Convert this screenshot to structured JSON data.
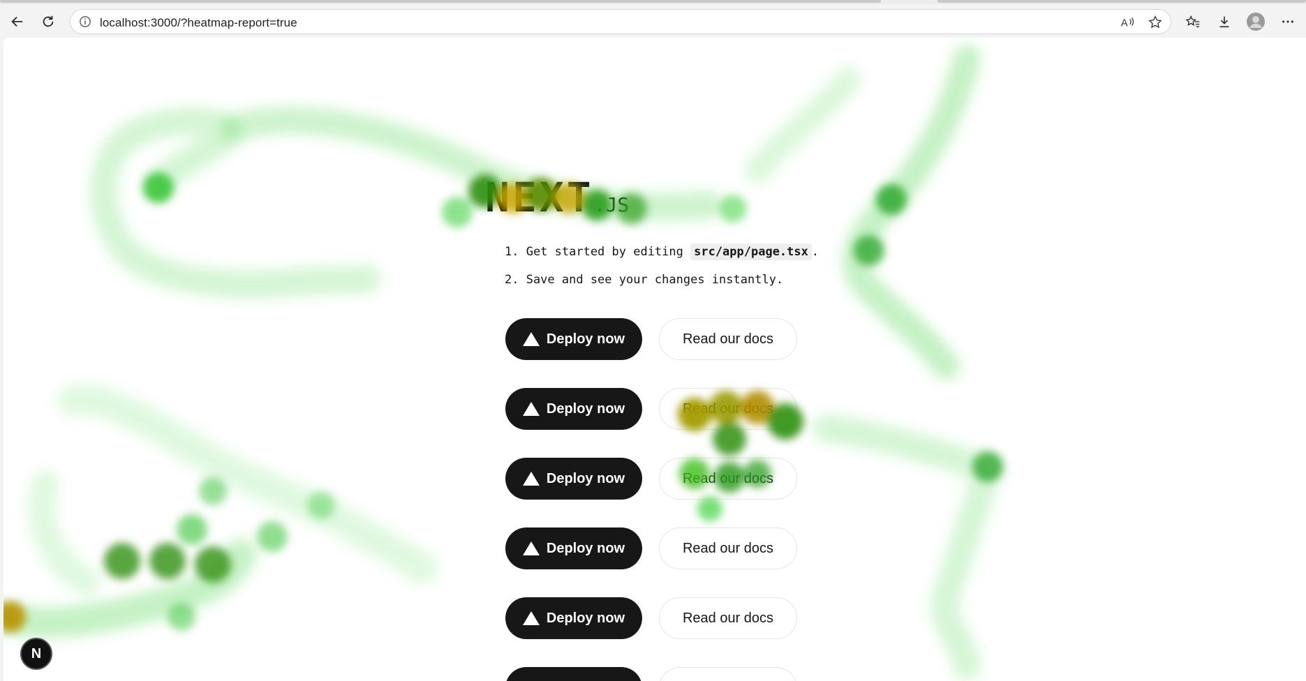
{
  "browser": {
    "url": "localhost:3000/?heatmap-report=true"
  },
  "page": {
    "logo": "NEXT",
    "logo_suffix": ".JS",
    "step1_prefix": "1. Get started by editing ",
    "step1_code": "src/app/page.tsx",
    "step1_suffix": ".",
    "step2": "2. Save and see your changes instantly.",
    "button_rows": [
      {
        "primary": "Deploy now",
        "secondary": "Read our docs"
      },
      {
        "primary": "Deploy now",
        "secondary": "Read our docs"
      },
      {
        "primary": "Deploy now",
        "secondary": "Read our docs"
      },
      {
        "primary": "Deploy now",
        "secondary": "Read our docs"
      },
      {
        "primary": "Deploy now",
        "secondary": "Read our docs"
      }
    ],
    "badge": "N"
  },
  "colors": {
    "heat_low": "#3fd13f",
    "heat_mid": "#2a9d1f",
    "heat_high": "#c9a400",
    "primary_button": "#171717"
  }
}
